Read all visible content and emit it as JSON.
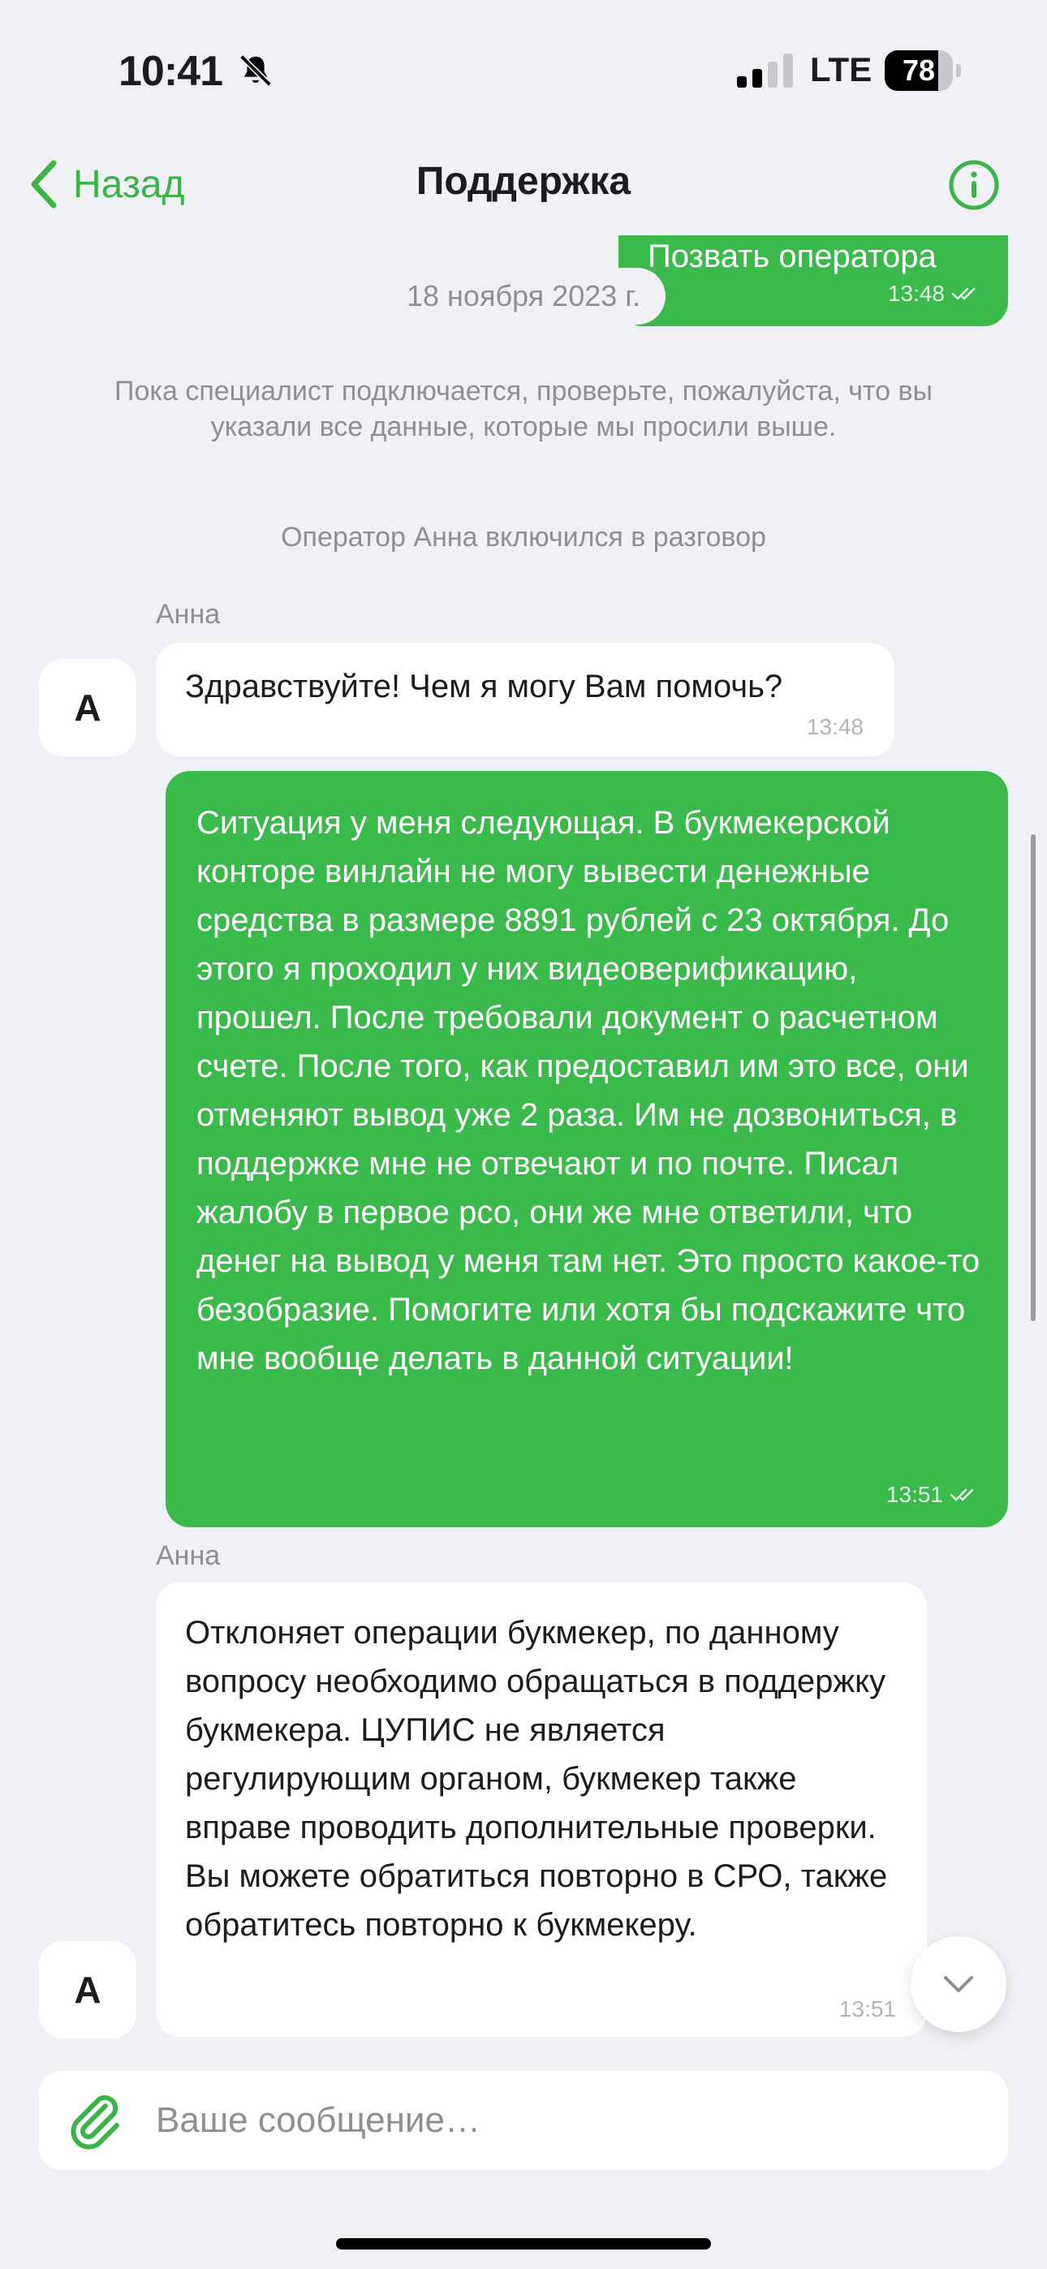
{
  "status_bar": {
    "time": "10:41",
    "network": "LTE",
    "battery": "78",
    "battery_level": 0.78,
    "icons": [
      "bell-slash-icon",
      "signal-icon",
      "battery-icon"
    ]
  },
  "nav": {
    "back_label": "Назад",
    "title": "Поддержка",
    "accent": "#3cb34a"
  },
  "messages": {
    "m1": {
      "text": "Позвать оператора",
      "time": "13:48"
    },
    "date": "18 ноября 2023 г.",
    "system_note": "Пока специалист подключается, проверьте, пожалуйста, что вы указали все данные, которые мы просили выше.",
    "operator_joined": "Оператор Анна включился в разговор",
    "m2": {
      "sender": "Анна",
      "avatar": "А",
      "text": "Здравствуйте! Чем я могу Вам помочь?",
      "time": "13:48"
    },
    "m3": {
      "text": "Ситуация у меня следующая. В букмекерской конторе винлайн не могу вывести денежные средства в размере 8891 рублей с 23 октября. До этого я проходил у них видеоверификацию, прошел. После требовали документ о расчетном счете. После того, как предоставил им это все, они отменяют вывод уже 2 раза. Им не дозвониться, в поддержке мне не отвечают и по почте. Писал жалобу в первое рсо, они же мне ответили, что денег на вывод у меня там нет. Это просто какое-то безобразие. Помогите или хотя бы подскажите что мне вообще делать в данной ситуации!",
      "time": "13:51"
    },
    "m4": {
      "sender": "Анна",
      "avatar": "А",
      "text": "Отклоняет операции букмекер, по данному вопросу необходимо обращаться в поддержку букмекера. ЦУПИС не является регулирующим органом, букмекер также вправе проводить дополнительные проверки. Вы можете обратиться повторно в СРО, также обратитесь повторно к букмекеру.",
      "time": "13:51"
    }
  },
  "composer": {
    "placeholder": "Ваше сообщение…"
  },
  "colors": {
    "background": "#f0f1f5",
    "outgoing_bubble": "#3cb94b",
    "incoming_bubble": "#ffffff"
  }
}
